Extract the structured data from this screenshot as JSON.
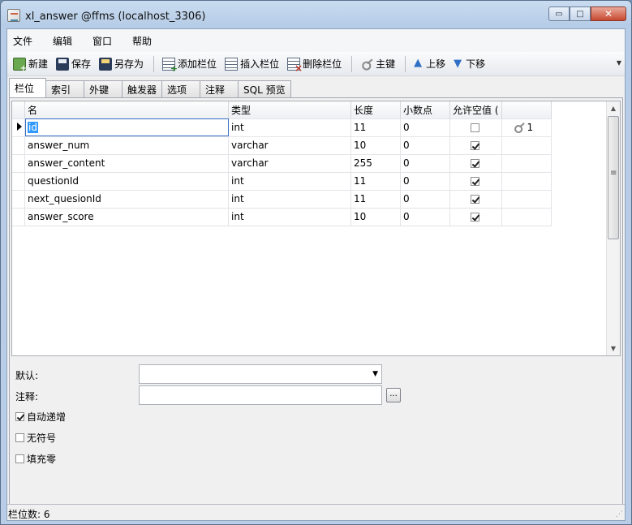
{
  "window": {
    "title": "xl_answer @ffms (localhost_3306)",
    "minimize": "▭",
    "maximize": "□",
    "close": "✕"
  },
  "menu": [
    "文件",
    "编辑",
    "窗口",
    "帮助"
  ],
  "toolbar": {
    "new": "新建",
    "save": "保存",
    "save_as": "另存为",
    "add_field": "添加栏位",
    "insert_field": "插入栏位",
    "delete_field": "删除栏位",
    "primary_key": "主键",
    "move_up": "上移",
    "move_down": "下移"
  },
  "tabs": [
    "栏位",
    "索引",
    "外键",
    "触发器",
    "选项",
    "注释",
    "SQL 预览"
  ],
  "grid": {
    "headers": [
      "名",
      "类型",
      "长度",
      "小数点",
      "允许空值 ("
    ],
    "rows": [
      {
        "name": "id",
        "type": "int",
        "length": "11",
        "decimals": "0",
        "nullable": false,
        "key": "1"
      },
      {
        "name": "answer_num",
        "type": "varchar",
        "length": "10",
        "decimals": "0",
        "nullable": true,
        "key": ""
      },
      {
        "name": "answer_content",
        "type": "varchar",
        "length": "255",
        "decimals": "0",
        "nullable": true,
        "key": ""
      },
      {
        "name": "questionId",
        "type": "int",
        "length": "11",
        "decimals": "0",
        "nullable": true,
        "key": ""
      },
      {
        "name": "next_quesionId",
        "type": "int",
        "length": "11",
        "decimals": "0",
        "nullable": true,
        "key": ""
      },
      {
        "name": "answer_score",
        "type": "int",
        "length": "10",
        "decimals": "0",
        "nullable": true,
        "key": ""
      }
    ]
  },
  "props": {
    "default_label": "默认:",
    "comment_label": "注释:",
    "ellipsis": "...",
    "auto_increment": "自动递增",
    "auto_increment_checked": true,
    "unsigned": "无符号",
    "unsigned_checked": false,
    "zerofill": "填充零",
    "zerofill_checked": false
  },
  "status": {
    "field_count": "栏位数: 6"
  }
}
